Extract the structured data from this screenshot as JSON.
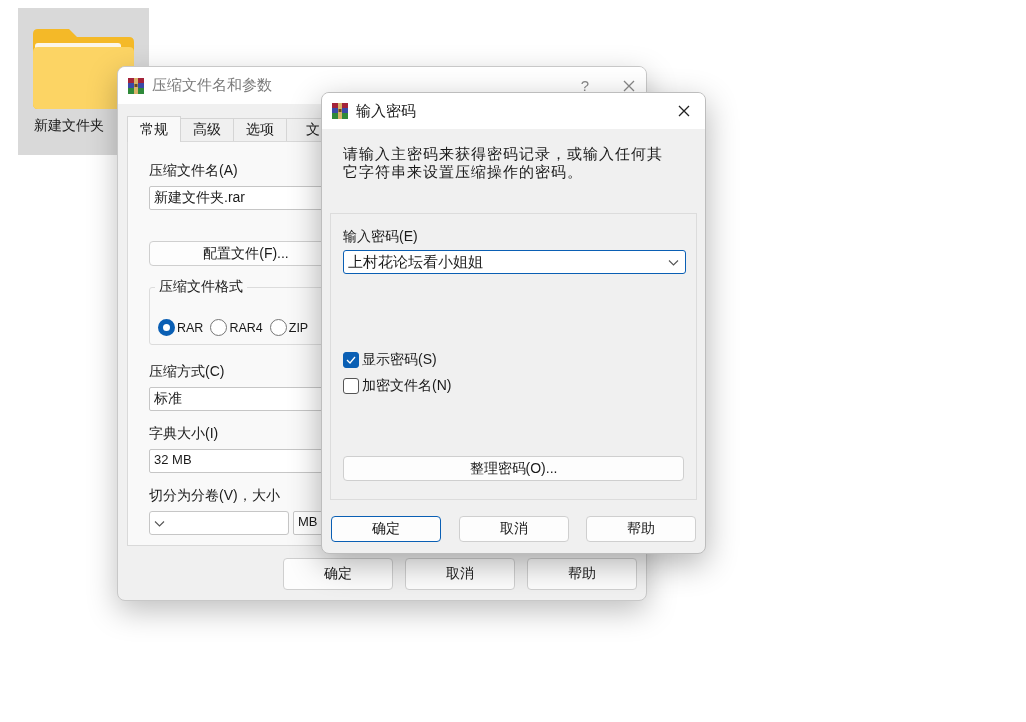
{
  "desktop_icon": {
    "label": "新建文件夹",
    "selected": true
  },
  "archive_window": {
    "title": "压缩文件名和参数",
    "help_button": "?",
    "tabs": [
      {
        "label": "常规",
        "selected": true
      },
      {
        "label": "高级",
        "selected": false
      },
      {
        "label": "选项",
        "selected": false
      },
      {
        "label": "文",
        "selected": false
      }
    ],
    "archive_name": {
      "label": "压缩文件名(A)",
      "value": "新建文件夹.rar"
    },
    "profiles_button": "配置文件(F)...",
    "format": {
      "label": "压缩文件格式",
      "options": [
        {
          "label": "RAR",
          "selected": true
        },
        {
          "label": "RAR4",
          "selected": false
        },
        {
          "label": "ZIP",
          "selected": false
        }
      ]
    },
    "method": {
      "label": "压缩方式(C)",
      "value": "标准"
    },
    "dictionary": {
      "label": "字典大小(I)",
      "value": "32 MB"
    },
    "split": {
      "label": "切分为分卷(V)，大小",
      "unit": "MB"
    },
    "buttons": [
      {
        "label": "确定",
        "default": false
      },
      {
        "label": "取消",
        "default": false
      },
      {
        "label": "帮助",
        "default": false
      }
    ]
  },
  "password_dialog": {
    "title": "输入密码",
    "message": "请输入主密码来获得密码记录，或输入任何其它字符串来设置压缩操作的密码。",
    "password": {
      "label": "输入密码(E)",
      "value": "上村花论坛看小姐姐"
    },
    "options": [
      {
        "label": "显示密码(S)",
        "checked": true
      },
      {
        "label": "加密文件名(N)",
        "checked": false
      }
    ],
    "organize_button": "整理密码(O)...",
    "buttons": [
      {
        "label": "确定",
        "default": true
      },
      {
        "label": "取消",
        "default": false
      },
      {
        "label": "帮助",
        "default": false
      }
    ]
  }
}
